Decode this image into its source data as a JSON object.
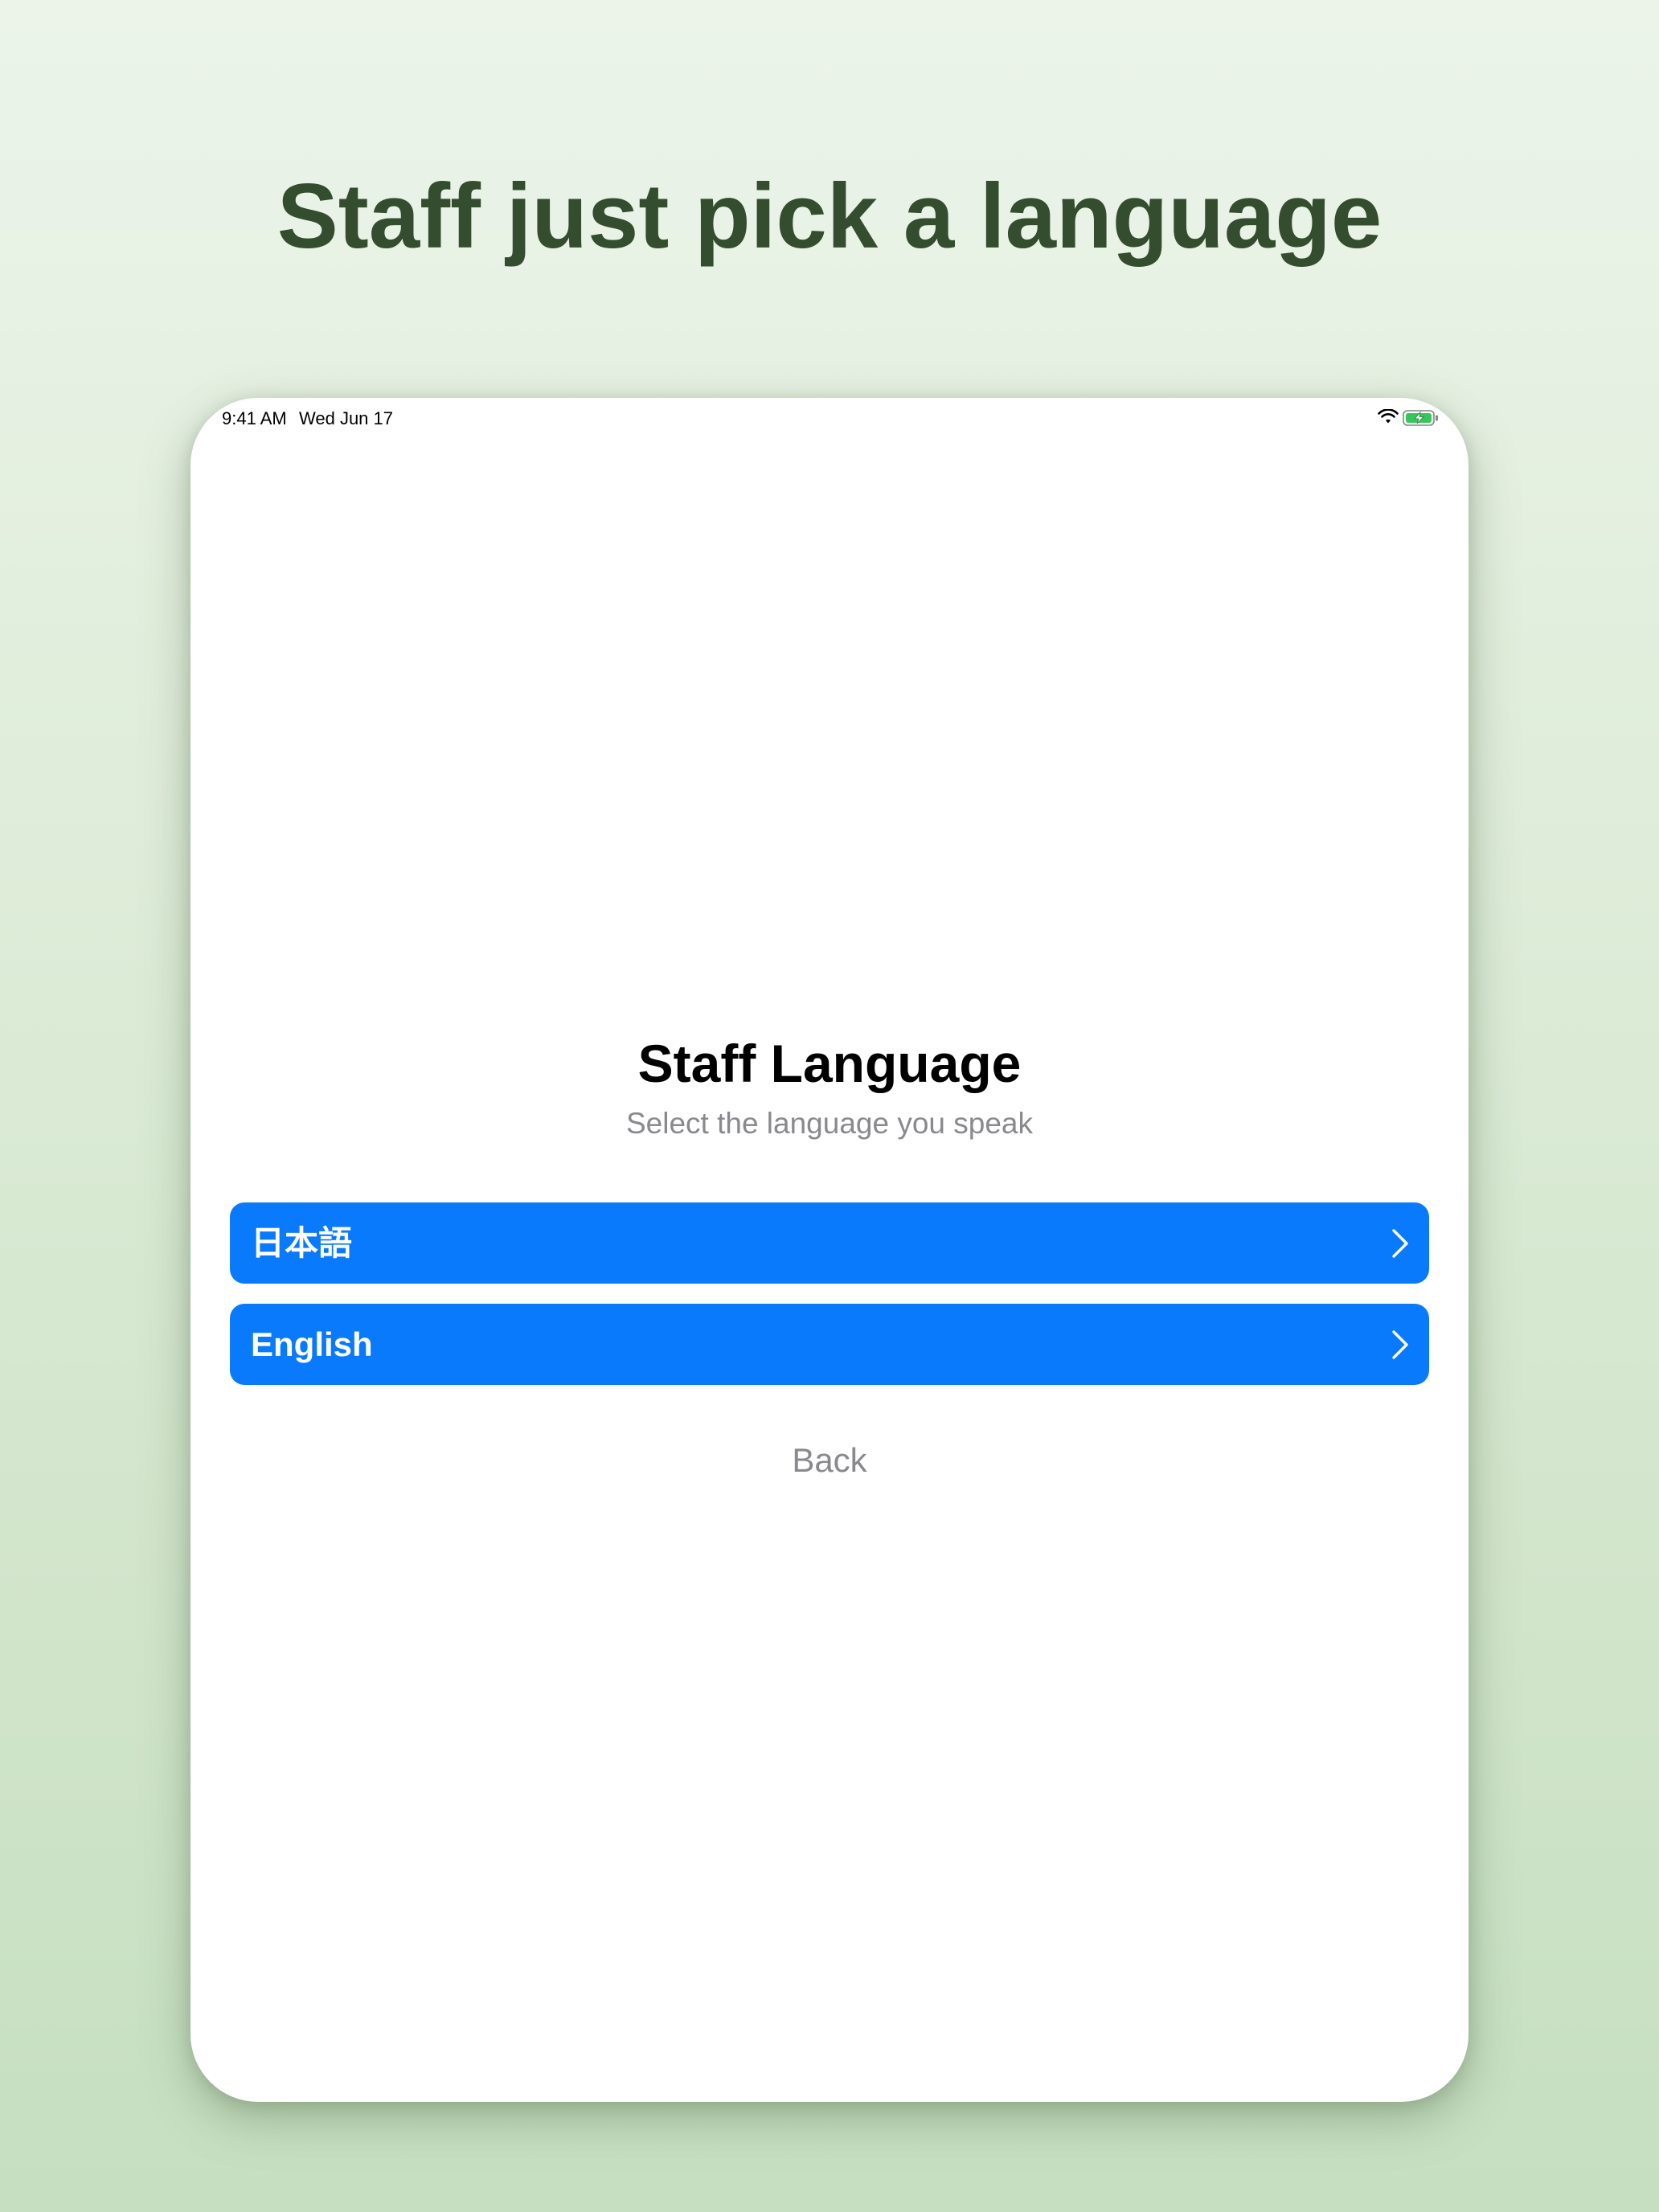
{
  "headline": "Staff just pick a language",
  "status_bar": {
    "time": "9:41 AM",
    "date": "Wed Jun 17",
    "wifi_icon": "wifi-icon",
    "battery_icon": "battery-charging-icon",
    "battery_color": "#34c759"
  },
  "screen": {
    "title": "Staff Language",
    "subtitle": "Select the language you speak",
    "languages": [
      {
        "label": "日本語",
        "icon": "chevron-right-icon"
      },
      {
        "label": "English",
        "icon": "chevron-right-icon"
      }
    ],
    "back_label": "Back"
  },
  "colors": {
    "accent": "#0a7afc",
    "headline": "#334d2e",
    "muted_text": "#8a8a8e"
  }
}
